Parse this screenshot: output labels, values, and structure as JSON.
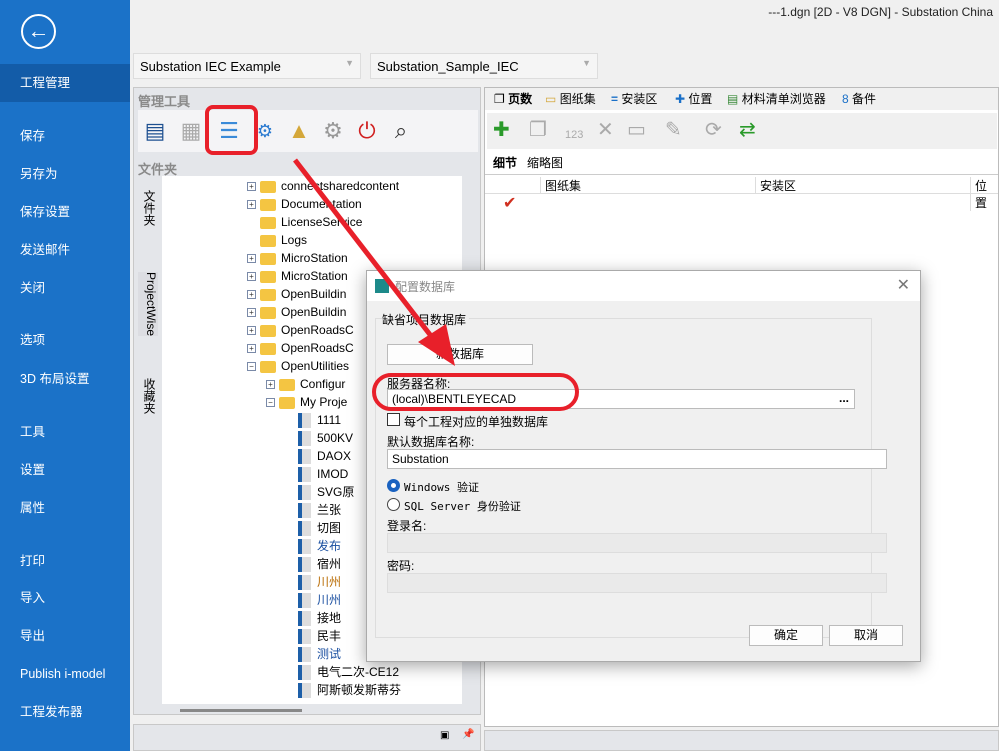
{
  "window_title": "---1.dgn [2D - V8 DGN] - Substation China",
  "sidebar": {
    "back_icon": "back-arrow-icon",
    "items": [
      "工程管理",
      "保存",
      "另存为",
      "保存设置",
      "发送邮件",
      "关闭",
      "选项",
      "3D 布局设置",
      "工具",
      "设置",
      "属性",
      "打印",
      "导入",
      "导出",
      "Publish i-model",
      "工程发布器"
    ]
  },
  "dropdowns": [
    "Substation IEC Example",
    "Substation_Sample_IEC"
  ],
  "left": {
    "tools_header": "管理工具",
    "folder_header": "文件夹",
    "side_tabs": [
      "文件夹",
      "ProjectWise",
      "收藏夹"
    ],
    "tree": [
      {
        "t": "connectsharedcontent",
        "lvl": 1,
        "pm": "+"
      },
      {
        "t": "Documentation",
        "lvl": 1,
        "pm": "+"
      },
      {
        "t": "LicenseService",
        "lvl": 1,
        "pm": ""
      },
      {
        "t": "Logs",
        "lvl": 1,
        "pm": ""
      },
      {
        "t": "MicroStation",
        "lvl": 1,
        "pm": "+"
      },
      {
        "t": "MicroStation",
        "lvl": 1,
        "pm": "+"
      },
      {
        "t": "OpenBuildin",
        "lvl": 1,
        "pm": "+"
      },
      {
        "t": "OpenBuildin",
        "lvl": 1,
        "pm": "+"
      },
      {
        "t": "OpenRoadsC",
        "lvl": 1,
        "pm": "+"
      },
      {
        "t": "OpenRoadsC",
        "lvl": 1,
        "pm": "+"
      },
      {
        "t": "OpenUtilities",
        "lvl": 1,
        "pm": "−"
      },
      {
        "t": "Configur",
        "lvl": 2,
        "pm": "+"
      },
      {
        "t": "My Proje",
        "lvl": 2,
        "pm": "−"
      },
      {
        "t": "1111",
        "lvl": 3
      },
      {
        "t": "500KV",
        "lvl": 3
      },
      {
        "t": "DAOX",
        "lvl": 3
      },
      {
        "t": "IMOD",
        "lvl": 3
      },
      {
        "t": "SVG原",
        "lvl": 3
      },
      {
        "t": "兰张",
        "lvl": 3
      },
      {
        "t": "切图",
        "lvl": 3
      },
      {
        "t": "发布",
        "lvl": 3,
        "c": "#1a4fa0"
      },
      {
        "t": "宿州",
        "lvl": 3
      },
      {
        "t": "川州",
        "lvl": 3,
        "c": "#b86a00"
      },
      {
        "t": "川州",
        "lvl": 3,
        "c": "#1a4fa0"
      },
      {
        "t": "接地",
        "lvl": 3
      },
      {
        "t": "民丰",
        "lvl": 3
      },
      {
        "t": "测试",
        "lvl": 3,
        "c": "#1a4fa0"
      },
      {
        "t": "电气二次-CE12",
        "lvl": 3
      },
      {
        "t": "阿斯顿发斯蒂芬",
        "lvl": 3
      }
    ]
  },
  "right": {
    "tabs": [
      "页数",
      "图纸集",
      "安装区",
      "位置",
      "材料清单浏览器",
      "备件"
    ],
    "subtabs": [
      "细节",
      "缩略图"
    ],
    "columns": [
      "图纸集",
      "安装区",
      "位置"
    ]
  },
  "dialog": {
    "title": "配置数据库",
    "group": "缺省项目数据库",
    "new_db_button": "新数据库",
    "server_label": "服务器名称:",
    "server_value": "(local)\\BENTLEYECAD",
    "browse": "...",
    "separate_db_label": "每个工程对应的单独数据库",
    "default_db_label": "默认数据库名称:",
    "default_db_value": "Substation",
    "auth_windows": "Windows 验证",
    "auth_sql": "SQL Server 身份验证",
    "login_label": "登录名:",
    "password_label": "密码:",
    "ok": "确定",
    "cancel": "取消"
  }
}
